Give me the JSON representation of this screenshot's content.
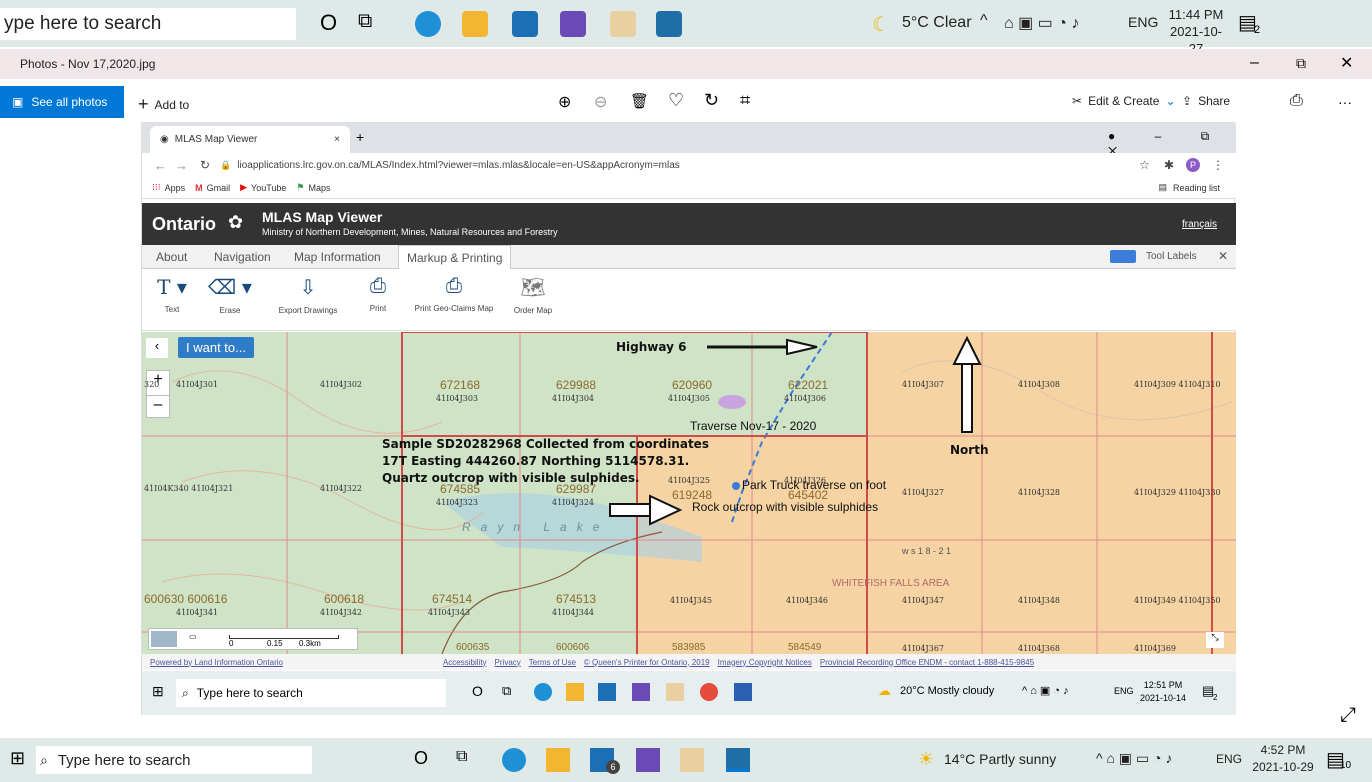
{
  "top_taskbar": {
    "search_text": "ype here to search",
    "weather": "5°C  Clear",
    "lang": "ENG",
    "time": "11:44 PM",
    "date": "2021-10-27",
    "notif_count": "2"
  },
  "photos": {
    "title": "Photos - Nov 17,2020.jpg",
    "see_all": "See all photos",
    "add_to": "Add to",
    "edit_create": "Edit & Create",
    "share": "Share",
    "more": "···"
  },
  "browser": {
    "tab_title": "MLAS Map Viewer",
    "url": "lioapplications.lrc.gov.on.ca/MLAS/Index.html?viewer=mlas.mlas&locale=en-US&appAcronym=mlas",
    "bookmarks": [
      "Apps",
      "Gmail",
      "YouTube",
      "Maps"
    ],
    "reading_list": "Reading list",
    "profile_initial": "P"
  },
  "mlas": {
    "brand": "Ontario",
    "title": "MLAS Map Viewer",
    "subtitle": "Ministry of Northern Development, Mines, Natural Resources and Forestry",
    "lang_link": "français",
    "tabs": [
      "About",
      "Navigation",
      "Map Information",
      "Markup & Printing"
    ],
    "tool_labels": "Tool Labels",
    "tools": [
      "Text",
      "Erase",
      "Export Drawings",
      "Print",
      "Print Geo-Claims Map",
      "Order Map"
    ],
    "i_want_to": "I want to...",
    "scale": [
      "0",
      "0.15",
      "0.3km"
    ],
    "footer_left": "Powered by Land Information Ontario",
    "footer_links": [
      "Accessibility",
      "Privacy",
      "Terms of Use",
      "© Queen's Printer for Ontario, 2019",
      "Imagery Copyright Notices",
      "Provincial Recording Office ENDM - contact 1-888-415-9845"
    ]
  },
  "map": {
    "row1": [
      {
        "claim": "",
        "cell": "41I04J301"
      },
      {
        "claim": "",
        "cell": "41I04J302"
      },
      {
        "claim": "672168",
        "cell": "41I04J303"
      },
      {
        "claim": "629988",
        "cell": "41I04J304"
      },
      {
        "claim": "620960",
        "cell": "41I04J305"
      },
      {
        "claim": "622021",
        "cell": "41I04J306"
      },
      {
        "claim": "",
        "cell": "41I04J307"
      },
      {
        "claim": "",
        "cell": "41I04J308"
      },
      {
        "claim": "",
        "cell": "41I04J309 41I04J310"
      }
    ],
    "row2": [
      {
        "claim": "",
        "cell": "41I04K340  41I04J321"
      },
      {
        "claim": "",
        "cell": "41I04J322"
      },
      {
        "claim": "674585",
        "cell": "41I04J323"
      },
      {
        "claim": "629987",
        "cell": "41I04J324"
      },
      {
        "claim": "619248",
        "cell": "41I04J325"
      },
      {
        "claim": "645402",
        "cell": "41I04J326"
      },
      {
        "claim": "",
        "cell": "41I04J327"
      },
      {
        "claim": "",
        "cell": "41I04J328"
      },
      {
        "claim": "",
        "cell": "41I04J329 41I04J330"
      }
    ],
    "row3": [
      {
        "claim": "600630  600616",
        "cell": "41I04J341"
      },
      {
        "claim": "600618",
        "cell": "41I04J342"
      },
      {
        "claim": "674514",
        "cell": "41I04J343"
      },
      {
        "claim": "674513",
        "cell": "41I04J344"
      },
      {
        "claim": "",
        "cell": "41I04J345"
      },
      {
        "claim": "",
        "cell": "41I04J346"
      },
      {
        "claim": "",
        "cell": "41I04J347"
      },
      {
        "claim": "",
        "cell": "41I04J348"
      },
      {
        "claim": "",
        "cell": "41I04J349 41I04J350"
      }
    ],
    "row4": [
      "600635",
      "600606",
      "583985",
      "584549",
      "41I04J367",
      "41I04J368",
      "41I04J369"
    ],
    "first_cell_label": "320",
    "lake_label": "Rayn Lake",
    "area_label": "WHITEFISH FALLS AREA",
    "ws_label": "w s 1 8 - 2 1",
    "annotations": {
      "highway": "Highway 6",
      "traverse": "Traverse Nov-17 - 2020",
      "north": "North",
      "sample": "Sample SD20282968 Collected from coordinates 17T Easting 444260.87 Northing 5114578.31. Quartz outcrop with visible sulphides.",
      "park": "Park Truck traverse on foot",
      "rock": "Rock outcrop with visible sulphides"
    }
  },
  "inner_taskbar": {
    "search_text": "Type here to search",
    "weather": "20°C  Mostly cloudy",
    "lang": "ENG",
    "time": "12:51 PM",
    "date": "2021-10-14",
    "notif_count": "2"
  },
  "bottom_taskbar": {
    "search_text": "Type here to search",
    "mail_badge": "6",
    "weather": "14°C  Partly sunny",
    "lang": "ENG",
    "time": "4:52 PM",
    "date": "2021-10-29",
    "notif_count": "10"
  },
  "colors": {
    "taskbar": "#dfe9e8",
    "photos_accent": "#0078d7",
    "mlas_header": "#333333",
    "grid_red": "#d9534f",
    "map_green": "#cfe3c6",
    "map_orange": "#f6d3a3"
  }
}
